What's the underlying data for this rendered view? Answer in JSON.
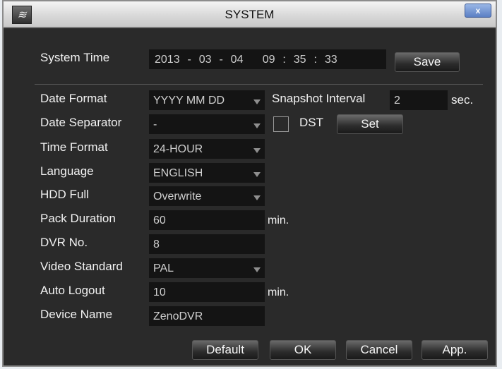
{
  "window": {
    "title": "SYSTEM",
    "close_label": "x",
    "icon_glyph": "≋"
  },
  "system_time": {
    "label": "System Time",
    "year": "2013",
    "month": "03",
    "day": "04",
    "hour": "09",
    "minute": "35",
    "second": "33",
    "sep_date": "-",
    "sep_time": ":",
    "save_label": "Save"
  },
  "fields": {
    "date_format": {
      "label": "Date Format",
      "value": "YYYY MM DD"
    },
    "date_separator": {
      "label": "Date Separator",
      "value": "-"
    },
    "time_format": {
      "label": "Time Format",
      "value": "24-HOUR"
    },
    "language": {
      "label": "Language",
      "value": "ENGLISH"
    },
    "hdd_full": {
      "label": "HDD Full",
      "value": "Overwrite"
    },
    "pack_duration": {
      "label": "Pack Duration",
      "value": "60",
      "unit": "min."
    },
    "dvr_no": {
      "label": "DVR No.",
      "value": "8"
    },
    "video_standard": {
      "label": "Video Standard",
      "value": "PAL"
    },
    "auto_logout": {
      "label": "Auto Logout",
      "value": "10",
      "unit": "min."
    },
    "device_name": {
      "label": "Device Name",
      "value": "ZenoDVR"
    }
  },
  "snapshot": {
    "label": "Snapshot Interval",
    "value": "2",
    "unit": "sec."
  },
  "dst": {
    "label": "DST",
    "checked": false,
    "set_label": "Set"
  },
  "footer": {
    "default_label": "Default",
    "ok_label": "OK",
    "cancel_label": "Cancel",
    "apply_label": "App."
  }
}
